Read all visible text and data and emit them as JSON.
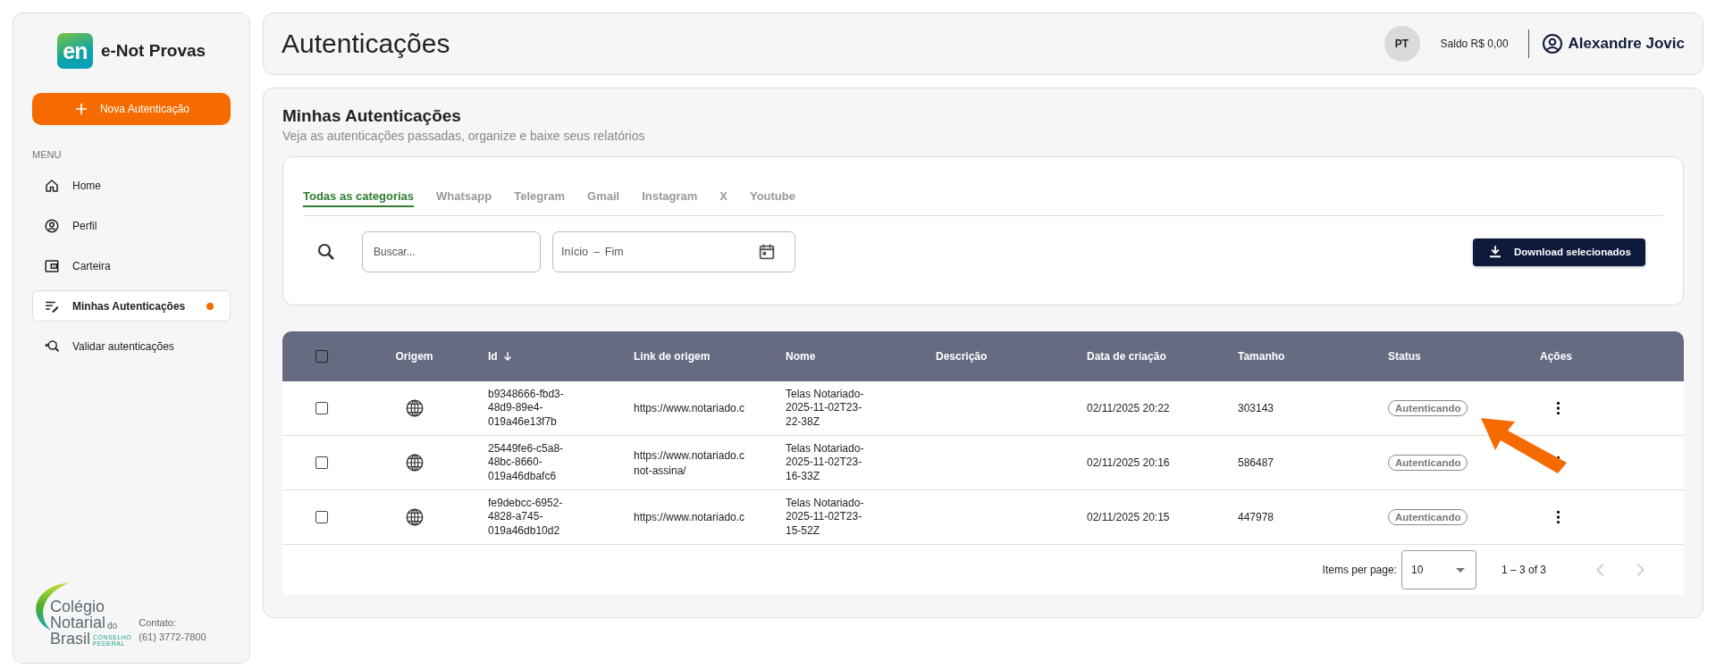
{
  "sidebar": {
    "brand_mark": "en",
    "brand": "e-Not Provas",
    "new_button": "Nova Autenticação",
    "menu_label": "MENU",
    "items": [
      {
        "label": "Home",
        "selected": false,
        "notification": false
      },
      {
        "label": "Perfil",
        "selected": false,
        "notification": false
      },
      {
        "label": "Carteira",
        "selected": false,
        "notification": false
      },
      {
        "label": "Minhas Autenticações",
        "selected": true,
        "notification": true
      },
      {
        "label": "Validar autenticações",
        "selected": false,
        "notification": false
      }
    ],
    "footer": {
      "logo": {
        "line1": "Colégio",
        "line2": "Notarial",
        "line2_small": "do",
        "line3": "Brasil",
        "sub1": "CONSELHO",
        "sub2": "FEDERAL"
      },
      "contact_label": "Contato:",
      "contact_phone": "(61) 3772-7800"
    }
  },
  "header": {
    "title": "Autenticações",
    "avatar": "PT",
    "balance": "Saldo R$ 0,00",
    "user": "Alexandre Jovic"
  },
  "content": {
    "title": "Minhas Autenticações",
    "subtitle": "Veja as autenticações passadas, organize e baixe seus relatórios",
    "tabs": [
      {
        "label": "Todas as categorias",
        "selected": true
      },
      {
        "label": "Whatsapp",
        "selected": false
      },
      {
        "label": "Telegram",
        "selected": false
      },
      {
        "label": "Gmail",
        "selected": false
      },
      {
        "label": "Instagram",
        "selected": false
      },
      {
        "label": "X",
        "selected": false
      },
      {
        "label": "Youtube",
        "selected": false
      }
    ],
    "search": {
      "placeholder": "Buscar..."
    },
    "date_range": {
      "start_placeholder": "Início",
      "separator": "–",
      "end_placeholder": "Fim"
    },
    "download_button": "Download selecionados"
  },
  "table": {
    "select_all": {
      "checked": false
    },
    "columns": [
      {
        "label": "Origem"
      },
      {
        "label": "Id",
        "sorted_desc": true
      },
      {
        "label": "Link de origem"
      },
      {
        "label": "Nome"
      },
      {
        "label": "Descrição"
      },
      {
        "label": "Data de criação"
      },
      {
        "label": "Tamanho"
      },
      {
        "label": "Status"
      },
      {
        "label": "Ações"
      }
    ],
    "rows": [
      {
        "checked": false,
        "kind": "web",
        "id": "b9348666-fbd3-48d9-89e4-019a46e13f7b",
        "link": [
          "https://www.notariado.c"
        ],
        "name": "Telas Notariado-2025-11-02T23-22-38Z",
        "date": "02/11/2025 20:22",
        "size": "303143",
        "status": "Autenticando"
      },
      {
        "checked": false,
        "kind": "web",
        "id": "25449fe6-c5a8-48bc-8660-019a46dbafc6",
        "link": [
          "https://www.notariado.c",
          "not-assina/"
        ],
        "name": "Telas Notariado-2025-11-02T23-16-33Z",
        "date": "02/11/2025 20:16",
        "size": "586487",
        "status": "Autenticando"
      },
      {
        "checked": false,
        "kind": "web",
        "id": "fe9debcc-6952-4828-a745-019a46db10d2",
        "link": [
          "https://www.notariado.c"
        ],
        "name": "Telas Notariado-2025-11-02T23-15-52Z",
        "date": "02/11/2025 20:15",
        "size": "447978",
        "status": "Autenticando"
      }
    ],
    "pagination": {
      "label": "Items per page:",
      "page_size": "10",
      "range": "1 – 3 of 3",
      "prev_disabled": true,
      "next_disabled": true
    }
  }
}
